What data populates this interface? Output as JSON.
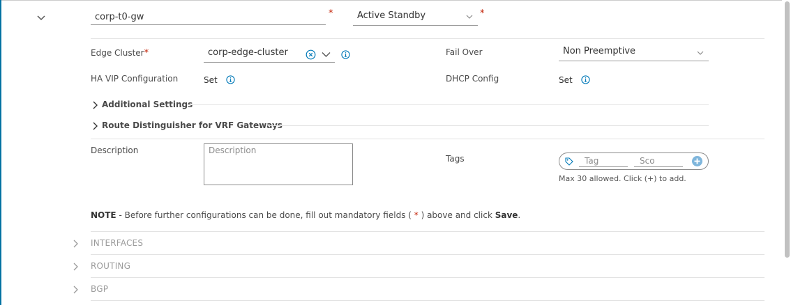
{
  "gateway": {
    "name_value": "corp-t0-gw",
    "ha_mode_value": "Active Standby",
    "required_mark": "*"
  },
  "edge_cluster": {
    "label": "Edge Cluster",
    "required_mark": "*",
    "value": "corp-edge-cluster"
  },
  "fail_over": {
    "label": "Fail Over",
    "value": "Non Preemptive"
  },
  "ha_vip": {
    "label": "HA VIP Configuration",
    "value": "Set"
  },
  "dhcp": {
    "label": "DHCP Config",
    "value": "Set"
  },
  "sections": {
    "additional_settings": "Additional Settings",
    "route_distinguisher": "Route Distinguisher for VRF Gateways"
  },
  "description": {
    "label": "Description",
    "placeholder": "Description"
  },
  "tags": {
    "label": "Tags",
    "tag_placeholder": "Tag",
    "scope_placeholder": "Sco",
    "hint": "Max 30 allowed. Click (+) to add."
  },
  "note": {
    "prefix": "NOTE",
    "text_before": " - Before further configurations can be done, fill out mandatory fields ( ",
    "mark": "*",
    "text_after": " ) above and click ",
    "save": "Save",
    "end": "."
  },
  "collapsed_sections": [
    {
      "label": "INTERFACES"
    },
    {
      "label": "ROUTING"
    },
    {
      "label": "BGP"
    }
  ],
  "colors": {
    "accent": "#0072a3",
    "required": "#c21d00",
    "info_blue": "#0079b8"
  },
  "icons": {
    "expand": "chevron-down-icon",
    "select": "chevron-down-icon",
    "clear": "clear-circle-icon",
    "info": "info-circle-icon",
    "section": "chevron-right-icon",
    "tag": "tag-icon",
    "add": "plus-circle-icon"
  }
}
